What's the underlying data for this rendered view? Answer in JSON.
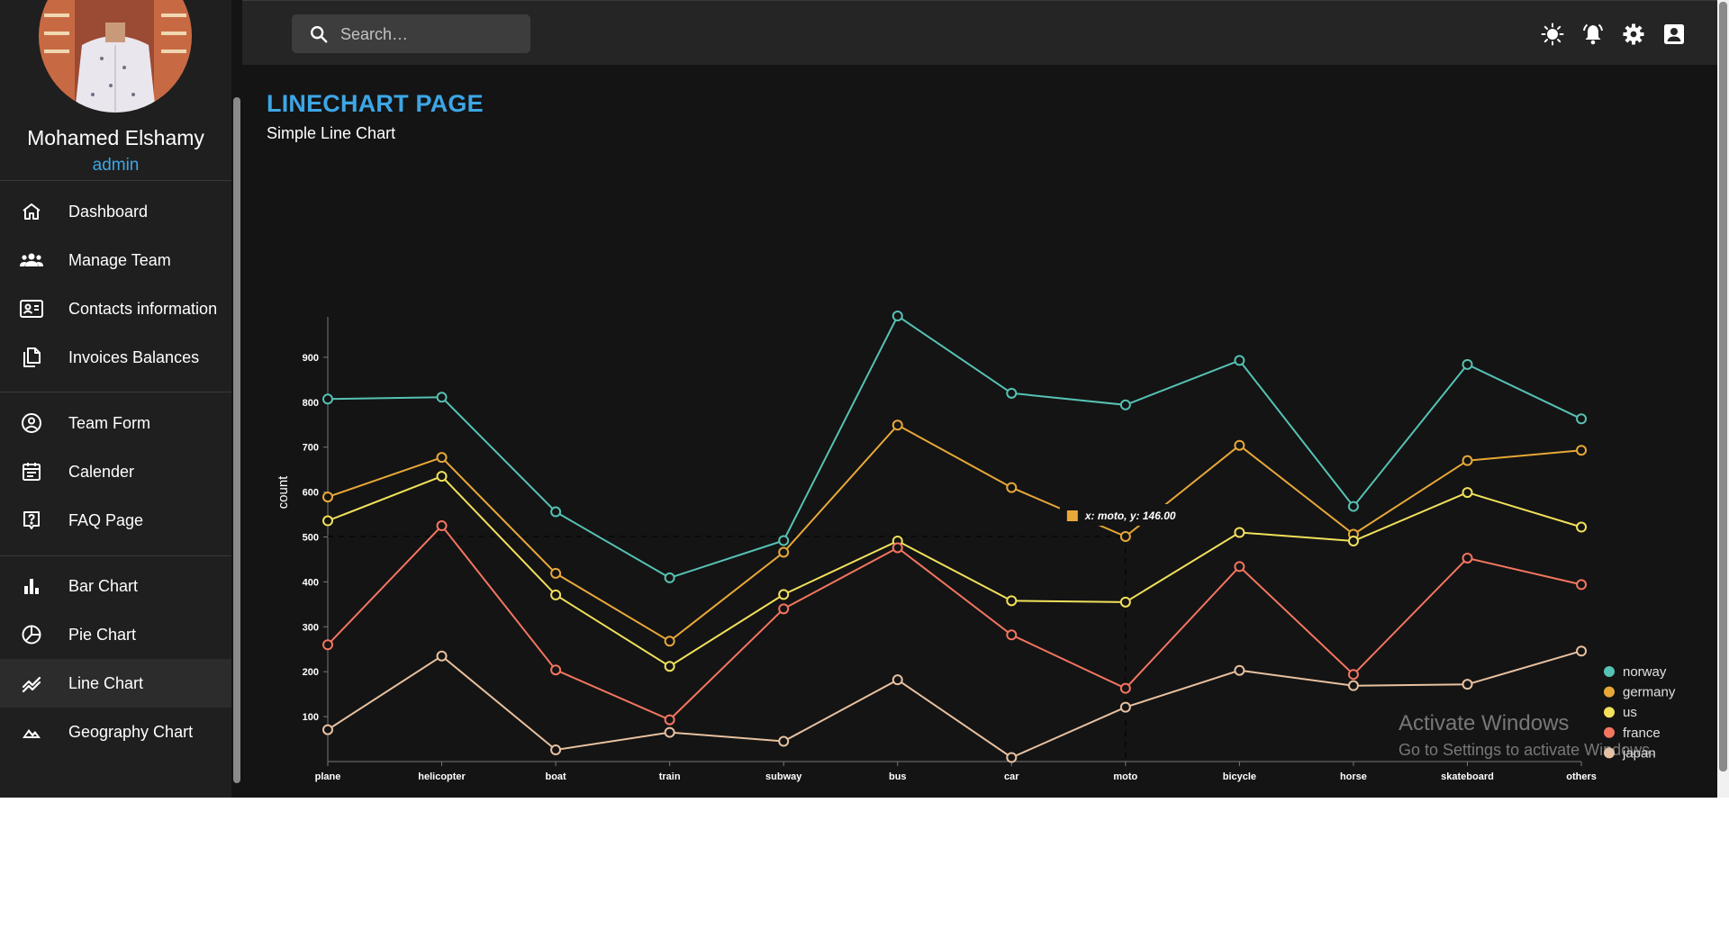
{
  "user": {
    "name": "Mohamed Elshamy",
    "role": "admin"
  },
  "nav": [
    {
      "label": "Dashboard",
      "icon": "home-icon",
      "name": "nav-dashboard",
      "active": false
    },
    {
      "label": "Manage Team",
      "icon": "people-icon",
      "name": "nav-manage-team",
      "active": false
    },
    {
      "label": "Contacts information",
      "icon": "contacts-icon",
      "name": "nav-contacts",
      "active": false
    },
    {
      "label": "Invoices Balances",
      "icon": "receipt-icon",
      "name": "nav-invoices",
      "active": false
    },
    {
      "label": "Team Form",
      "icon": "person-icon",
      "name": "nav-team-form",
      "active": false
    },
    {
      "label": "Calender",
      "icon": "calendar-icon",
      "name": "nav-calendar",
      "active": false
    },
    {
      "label": "FAQ Page",
      "icon": "help-icon",
      "name": "nav-faq",
      "active": false
    },
    {
      "label": "Bar Chart",
      "icon": "bar-chart-icon",
      "name": "nav-bar-chart",
      "active": false
    },
    {
      "label": "Pie Chart",
      "icon": "pie-chart-icon",
      "name": "nav-pie-chart",
      "active": false
    },
    {
      "label": "Line Chart",
      "icon": "line-chart-icon",
      "name": "nav-line-chart",
      "active": true
    },
    {
      "label": "Geography Chart",
      "icon": "map-icon",
      "name": "nav-geography-chart",
      "active": false
    }
  ],
  "search": {
    "placeholder": "Search…"
  },
  "topbar_icons": [
    "light-mode-icon",
    "notifications-icon",
    "settings-icon",
    "account-icon"
  ],
  "page": {
    "title": "LINECHART PAGE",
    "subtitle": "Simple Line Chart"
  },
  "tooltip": {
    "text": "x: moto, y: 146.00",
    "color": "#e8a838"
  },
  "watermark": {
    "title": "Activate Windows",
    "subtitle": "Go to Settings to activate Windows."
  },
  "colors": {
    "accent": "#3da6e6",
    "background": "#141414",
    "sidebar": "#1f1f1f"
  },
  "chart_data": {
    "type": "line",
    "ylabel": "count",
    "xlabel": "",
    "yticks": [
      100,
      200,
      300,
      400,
      500,
      600,
      700,
      800,
      900
    ],
    "categories": [
      "plane",
      "helicopter",
      "boat",
      "train",
      "subway",
      "bus",
      "car",
      "moto",
      "bicycle",
      "horse",
      "skateboard",
      "others"
    ],
    "stacked": true,
    "ylim": [
      0,
      990
    ],
    "legend_position": "bottom-right",
    "series": [
      {
        "name": "norway",
        "color": "#56c2b4",
        "values": [
          218,
          134,
          137,
          141,
          26,
          243,
          210,
          293,
          189,
          62,
          214,
          70
        ]
      },
      {
        "name": "germany",
        "color": "#e8a838",
        "values": [
          53,
          42,
          48,
          56,
          94,
          258,
          252,
          146,
          194,
          15,
          71,
          171
        ]
      },
      {
        "name": "us",
        "color": "#f1e15b",
        "values": [
          276,
          110,
          167,
          119,
          32,
          15,
          76,
          192,
          76,
          297,
          146,
          128
        ]
      },
      {
        "name": "france",
        "color": "#f47560",
        "values": [
          189,
          290,
          178,
          28,
          295,
          294,
          273,
          42,
          231,
          25,
          281,
          148
        ]
      },
      {
        "name": "japan",
        "color": "#e8c1a0",
        "values": [
          71,
          235,
          26,
          65,
          45,
          182,
          9,
          121,
          203,
          169,
          172,
          246
        ]
      }
    ],
    "active_point": {
      "series": "germany",
      "x": "moto"
    }
  }
}
